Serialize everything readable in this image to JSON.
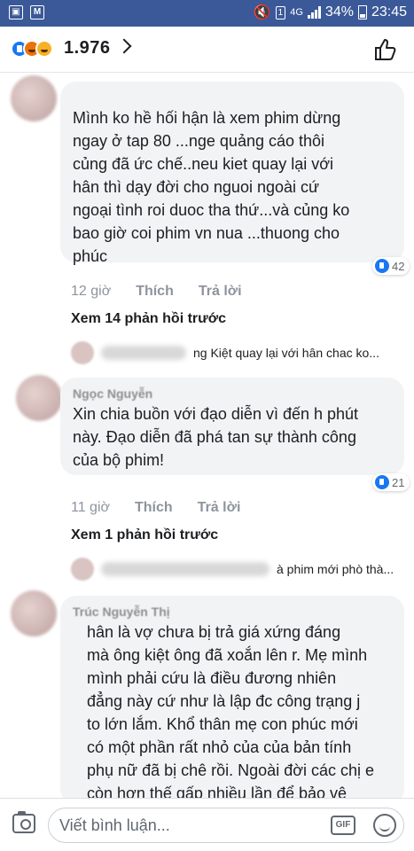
{
  "status_bar": {
    "notif_icons": [
      "image-icon",
      "mail-icon"
    ],
    "sim_number": "1",
    "network": "4G",
    "battery": "34%",
    "time": "23:45"
  },
  "header": {
    "reaction_icons": [
      "like-reaction-icon",
      "angry-reaction-icon",
      "haha-reaction-icon"
    ],
    "reaction_count": "1.976"
  },
  "comments": [
    {
      "author": "",
      "text": "Mình ko hề hối hận là xem phim dừng\nngay ở tap 80 ...nge quảng cáo thôi\ncủng đã ức chế..neu kiet quay lại với\nhân thì dạy đời cho nguoi ngoài cứ\nngoại tình roi duoc tha thứ...và củng ko\nbao giờ coi phim vn nua ...thuong cho\nphúc",
      "likes": "42",
      "time": "12 giờ",
      "like_label": "Thích",
      "reply_label": "Trả lời",
      "more_replies": "Xem 14 phản hồi trước",
      "reply_preview": "ng Kiệt  quay lại với  hân chac ko..."
    },
    {
      "author": "Ngọc Nguyễn",
      "text": "Xin chia buồn với đạo diễn vì đến h phút\nnày. Đạo diễn đã phá tan sự thành công\ncủa bộ phim!",
      "likes": "21",
      "time": "11 giờ",
      "like_label": "Thích",
      "reply_label": "Trả lời",
      "more_replies": "Xem 1 phản hồi trước",
      "reply_preview": "à phim mới phò thà..."
    },
    {
      "author": "Trúc Nguyễn Thị",
      "text": "hân là vợ chưa bị trả giá xứng đáng\nmà ông kiệt ông đã xoắn lên r. Mẹ mình\nmình phải cứu là điều đương nhiên\nđẳng này cứ như là lập đc công trạng j\nto lớn lắm. Khổ thân mẹ con phúc mới\ncó một phần rất nhỏ của của bản tính\nphụ nữ đã bị chê rồi. Ngoài đời các chị e\ncòn hơn thế gấp nhiều lần để bảo vệ"
    }
  ],
  "composer": {
    "placeholder": "Viết bình luận...",
    "gif_label": "GIF"
  }
}
